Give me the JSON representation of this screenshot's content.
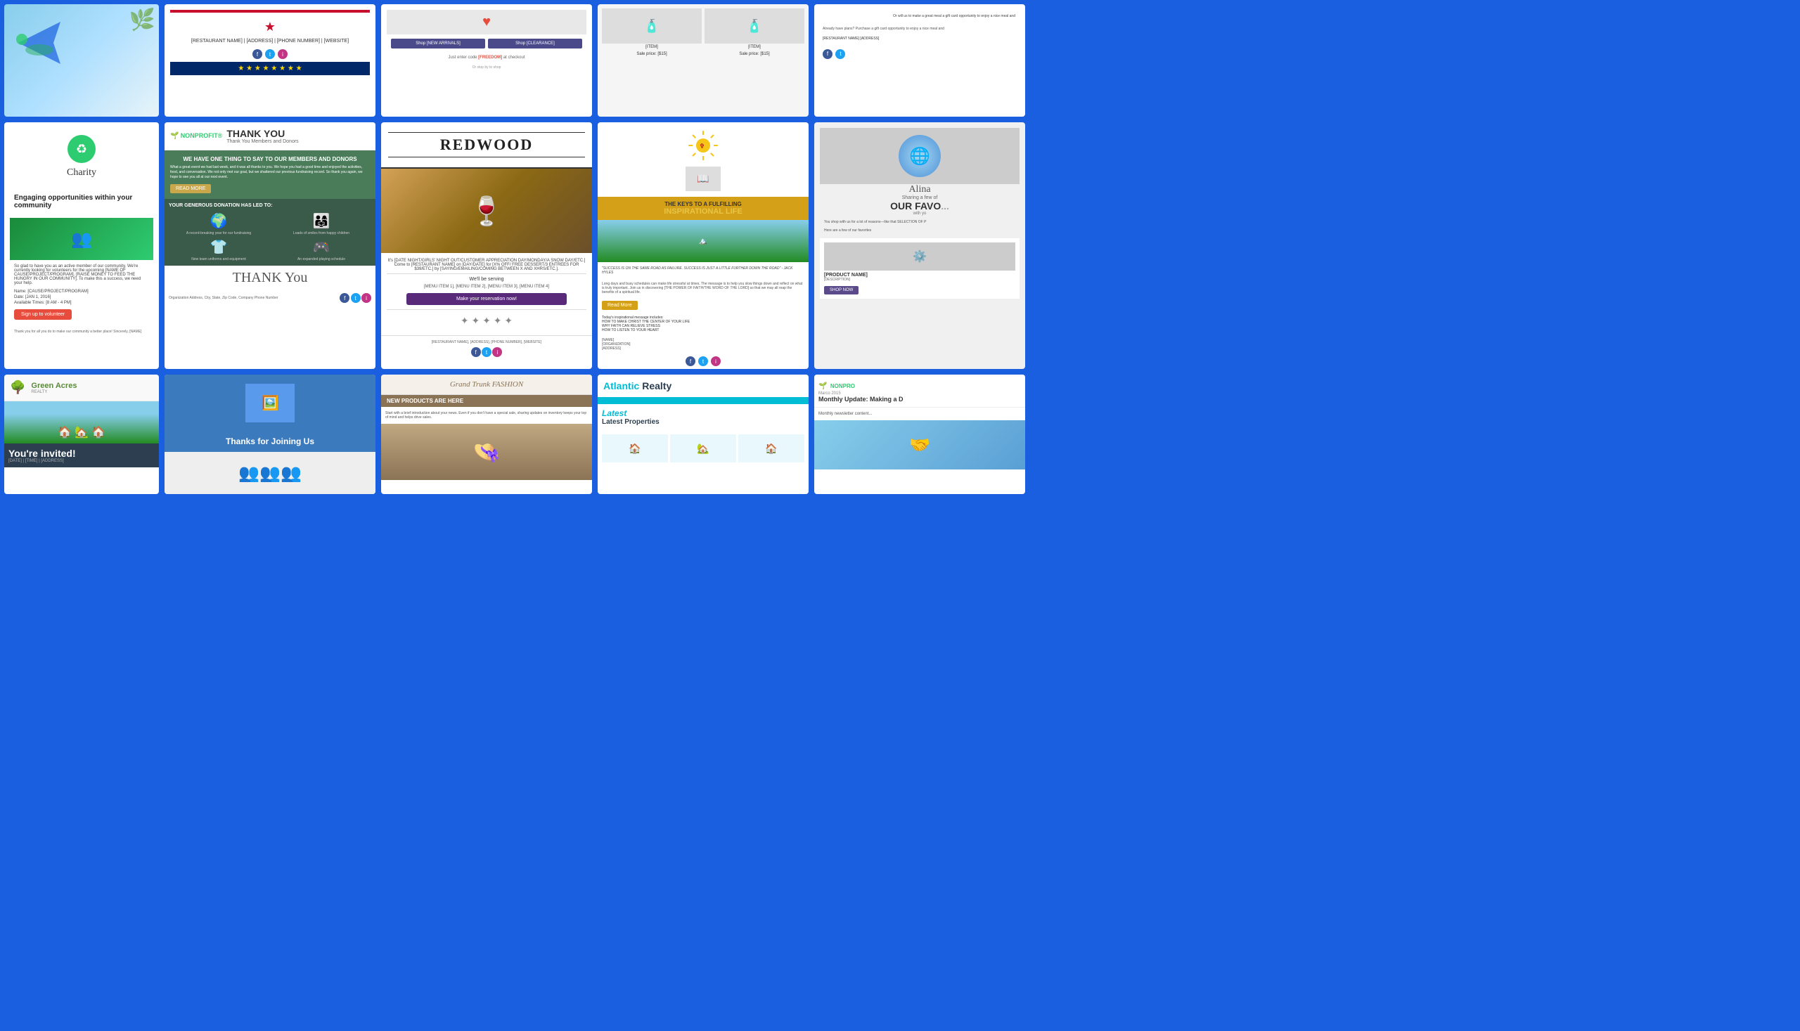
{
  "page": {
    "background": "#1a5fe0"
  },
  "row1": {
    "cards": [
      {
        "id": "r1c1",
        "type": "travel",
        "background": "sky-blue"
      },
      {
        "id": "r1c2",
        "type": "restaurant-patriotic",
        "restaurant_name": "[RESTAURANT NAME] | [ADDRESS] | [PHONE NUMBER] | [WEBSITE]"
      },
      {
        "id": "r1c3",
        "type": "shop-promo",
        "shop_new_arrivals": "Shop [NEW ARRIVALS]",
        "shop_clearance": "Shop [CLEARANCE]",
        "promo_text": "Just enter code [FREEDOM] at checkout",
        "sub_text": "Or stop by to shop"
      },
      {
        "id": "r1c4",
        "type": "product-sale",
        "item1": "[ITEM]",
        "item1_price": "Sale price: [$15]",
        "item2": "[ITEM]",
        "item2_price": "Sale price: [$15]"
      },
      {
        "id": "r1c5",
        "type": "restaurant-gift",
        "text": "Or will us to make a great meal a gift card opportunity to enjoy a nice meal and",
        "footer": "Already have plans? Purchase a gift card opportunity to enjoy a nice meal and"
      }
    ]
  },
  "row2": {
    "cards": [
      {
        "id": "r2c1",
        "type": "charity",
        "brand": "Charity",
        "tagline": "Engaging opportunities within your community",
        "body": "So glad to have you as an active member of our community. We're currently looking for volunteers for the upcoming [NAME OF CAUSE/PROJECT/PROGRAM]. [RAISE MONEY TO FEED THE HUNGRY IN OUR COMMUNITY]. To make this a success, we need your help.",
        "name_label": "Name: [CAUSE/PROJECT/PROGRAM]",
        "date_label": "Date: [JAN 1, 2016]",
        "times_label": "Available Times: [8 AM - 4 PM]",
        "signup_btn": "Sign up to volunteer",
        "footer": "Thank you for all you do to make our community a better place! Sincerely, [NAME]"
      },
      {
        "id": "r2c2",
        "type": "nonprofit-thankyou",
        "logo": "NONPROFIT®",
        "title": "THANK YOU",
        "subtitle": "Thank You Members and Donors",
        "headline": "WE HAVE ONE THING TO SAY TO OUR MEMBERS AND DONORS",
        "body": "What a great event we had last week, and it was all thanks to you. We hope you had a good time and enjoyed the activities, food, and conversation. We not only met our goal, but we shattered our previous fundraising record. So thank you again, we hope to see you all at our next event.",
        "read_more": "READ MORE",
        "donation_headline": "YOUR GENEROUS DONATION HAS LED TO:",
        "item1_icon": "🌍",
        "item1_text": "A record-breaking year for our fundraising",
        "item2_icon": "👨‍👩‍👧‍👦",
        "item2_text": "Loads of smiles from happy children",
        "item3_icon": "👕",
        "item3_text": "New team uniforms and equipment",
        "item4_icon": "🎮",
        "item4_text": "An expanded playing schedule",
        "thankyou": "THANK You",
        "org_address": "Organization Address, City, State, Zip Code, Company Phone Number"
      },
      {
        "id": "r2c3",
        "type": "restaurant-redwood",
        "name": "REDWOOD",
        "event_text": "It's [DATE NIGHT/GIRLS' NIGHT OUT/CUSTOMER APPRECIATION DAY/MONDAY/A SNOW DAY/ETC.] Come to [RESTAURANT NAME] on [DAY/DATE] for [X% OFF/ FREE DESSERT/3 ENTREES FOR $39/ETC.] by [SAYING/EMAILING/COMING BETWEEN X AND XHRS/ETC.].",
        "serving": "We'll be serving",
        "menu": "[MENU ITEM 1], [MENU ITEM 2], [MENU ITEM 3], [MENU ITEM 4]",
        "cta_btn": "Make your reservation now!",
        "footer": "[RESTAURANT NAME], [ADDRESS], [PHONE NUMBER], [WEBSITE]"
      },
      {
        "id": "r2c4",
        "type": "church-inspirational",
        "keys_text": "THE KEYS TO A FULFILLING",
        "inspirational": "INSPIRATIONAL LIFE",
        "quote": "\"SUCCESS IS ON THE SAME ROAD AS FAILURE. SUCCESS IS JUST A LITTLE FURTHER DOWN THE ROAD\" - JACK HYLES",
        "body": "Long days and busy schedules can make life stressful at times. The message is to help you slow things down and reflect on what is truly important. Join us in discovering [THE POWER OF FAITH/THE WORD OF THE LORD] so that we may all reap the benefits of a spiritual life.",
        "message_intro": "Today's inspirational message includes:",
        "msg1": "HOW TO MAKE CHRIST THE CENTER OF YOUR LIFE",
        "msg2": "WHY FAITH CAN RELIEVE STRESS",
        "msg3": "HOW TO LISTEN TO YOUR HEART",
        "read_more": "Read More",
        "name": "[NAME]",
        "org": "[ORGANIZATION]",
        "address": "[ADDRESS]"
      },
      {
        "id": "r2c5",
        "type": "newsletter-favorites",
        "brand": "Alina",
        "sharing_text": "Sharing a few of",
        "our_fav": "OUR FAVO",
        "with": "with yo",
        "body": "You shop with us for a lot of reasons—like that SELECTION OF P",
        "favorites_intro": "Here are a few of our favorites",
        "product_name": "[PRODUCT NAME]",
        "product_desc": "[DESCRIPTION]",
        "shop_now": "SHOP NOW"
      }
    ]
  },
  "row3": {
    "cards": [
      {
        "id": "r3c1",
        "type": "realty-invite",
        "brand": "Green Acres",
        "brand_sub": "REALTY",
        "invited_title": "You're invited!",
        "invited_details": "[DATE] | [TIME] | [ADDRESS]"
      },
      {
        "id": "r3c2",
        "type": "thanks-joining",
        "title": "Thanks for Joining Us",
        "image_icon": "🖼️"
      },
      {
        "id": "r3c3",
        "type": "fashion",
        "brand": "Grand Trunk FASHION",
        "banner": "NEW PRODUCTS ARE HERE",
        "body": "Start with a brief introduction about your news. Even if you don't have a special sale, sharing updates on inventory keeps your top of mind and helps drive sales."
      },
      {
        "id": "r3c4",
        "type": "atlantic-realty",
        "brand_atlantic": "Atlantic",
        "brand_realty": "Realty",
        "latest": "Latest Properties"
      },
      {
        "id": "r3c5",
        "type": "nonprofit-monthly",
        "logo": "NONPRO",
        "date": "Marco 2015",
        "title": "Monthly Update: Making a D"
      }
    ]
  },
  "social": {
    "facebook": "f",
    "twitter": "t",
    "instagram": "i"
  }
}
